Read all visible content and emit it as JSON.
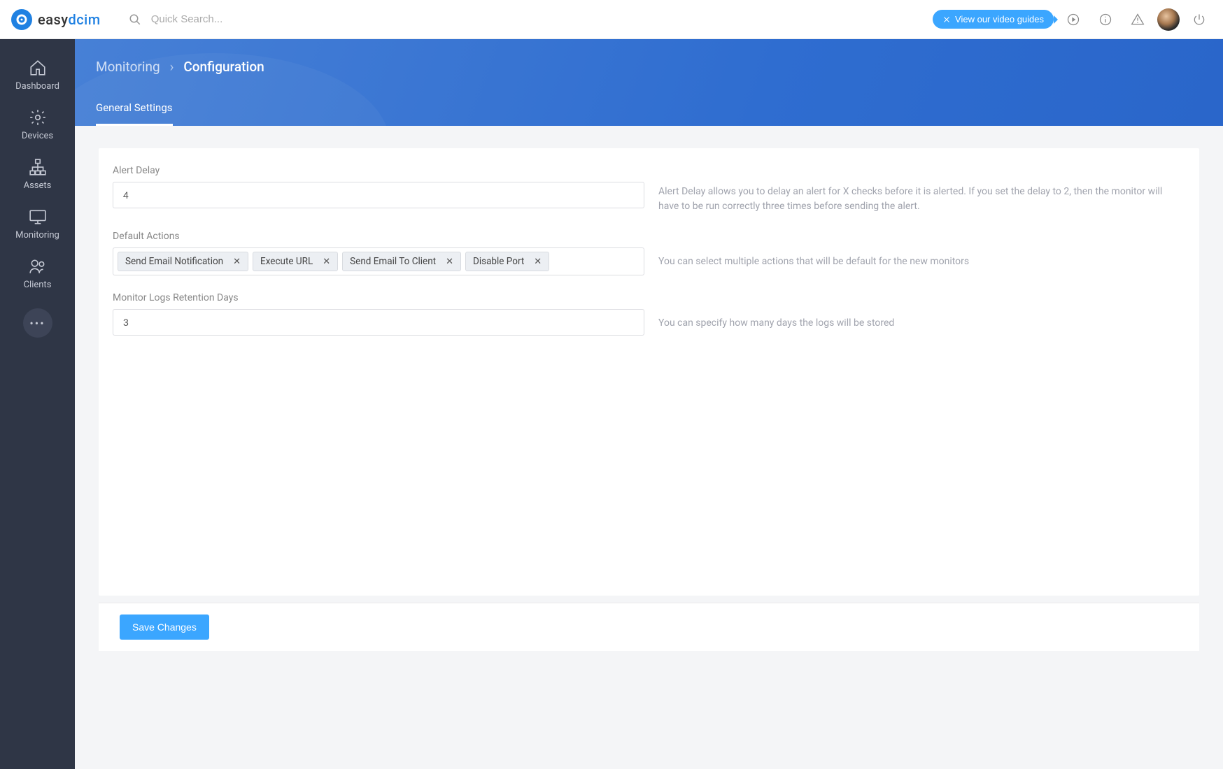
{
  "header": {
    "logo_easy": "easy",
    "logo_dcim": "dcim",
    "search_placeholder": "Quick Search...",
    "video_guides": "View our video guides"
  },
  "sidebar": {
    "items": [
      {
        "label": "Dashboard"
      },
      {
        "label": "Devices"
      },
      {
        "label": "Assets"
      },
      {
        "label": "Monitoring"
      },
      {
        "label": "Clients"
      }
    ],
    "more": "•••"
  },
  "breadcrumb": {
    "parent": "Monitoring",
    "current": "Configuration"
  },
  "tabs": {
    "general": "General Settings"
  },
  "form": {
    "alert_delay": {
      "label": "Alert Delay",
      "value": "4",
      "help": "Alert Delay allows you to delay an alert for X checks before it is alerted. If you set the delay to 2, then the monitor will have to be run correctly three times before sending the alert."
    },
    "default_actions": {
      "label": "Default Actions",
      "tags": [
        "Send Email Notification",
        "Execute URL",
        "Send Email To Client",
        "Disable Port"
      ],
      "help": "You can select multiple actions that will be default for the new monitors"
    },
    "retention": {
      "label": "Monitor Logs Retention Days",
      "value": "3",
      "help": "You can specify how many days the logs will be stored"
    }
  },
  "footer": {
    "save": "Save Changes"
  }
}
